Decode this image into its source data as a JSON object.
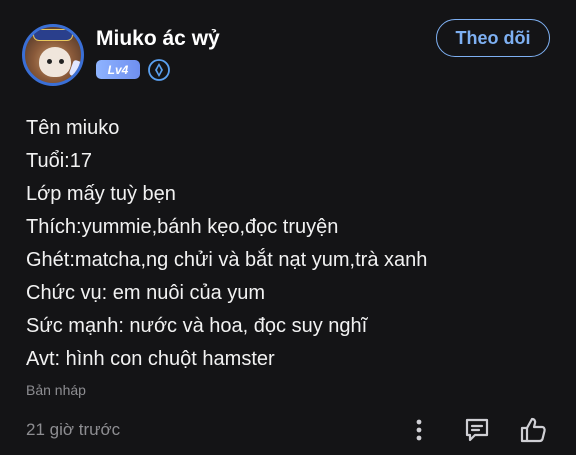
{
  "user": {
    "name": "Miuko ác wỷ",
    "level": "Lv4",
    "avatar_frame_text": "WRITER"
  },
  "follow_button": {
    "label": "Theo dõi"
  },
  "post": {
    "lines": [
      "Tên miuko",
      "Tuổi:17",
      "Lớp mấy tuỳ bẹn",
      "Thích:yummie,bánh kẹo,đọc truyện",
      "Ghét:matcha,ng chửi và bắt nạt yum,trà xanh",
      "Chức vụ: em nuôi của yum",
      "Sức mạnh: nước và hoa, đọc suy nghĩ",
      "Avt: hình con chuột hamster"
    ],
    "status": "Bản nháp",
    "time": "21 giờ trước"
  },
  "colors": {
    "background": "#141416",
    "accent": "#7eb0f2",
    "muted_text": "#8d8d91"
  },
  "icons": [
    "verified-icon",
    "more-icon",
    "comment-icon",
    "like-icon"
  ]
}
